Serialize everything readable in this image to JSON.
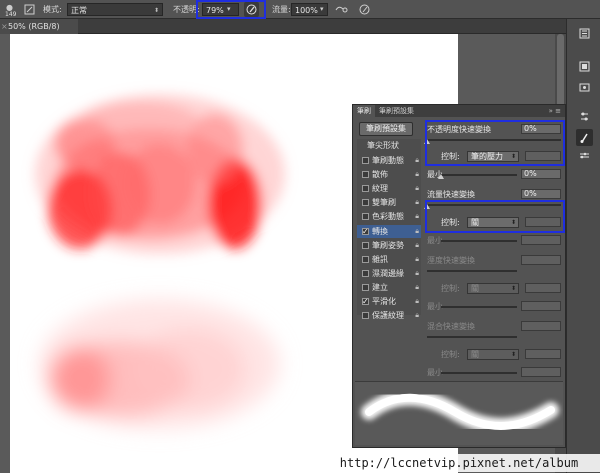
{
  "options_bar": {
    "brush_size": "149",
    "mode_label": "模式:",
    "mode_value": "正常",
    "opacity_label": "不透明:",
    "opacity_value": "79%",
    "flow_label": "流量:",
    "flow_value": "100%",
    "highlight_color": "#1f2ee0"
  },
  "document": {
    "tab_title": "50% (RGB/8)"
  },
  "panel": {
    "tabs": [
      "筆刷",
      "筆刷預設集"
    ],
    "preset_button": "筆刷預設集",
    "list_header": "筆尖形狀",
    "list": [
      {
        "label": "筆刷動態",
        "checked": false
      },
      {
        "label": "散佈",
        "checked": false
      },
      {
        "label": "紋理",
        "checked": false
      },
      {
        "label": "雙筆刷",
        "checked": false
      },
      {
        "label": "色彩動態",
        "checked": false
      },
      {
        "label": "轉換",
        "checked": true,
        "selected": true
      },
      {
        "label": "筆刷姿勢",
        "checked": false
      },
      {
        "label": "雜訊",
        "checked": false
      },
      {
        "label": "濕潤邊緣",
        "checked": false
      },
      {
        "label": "建立",
        "checked": false
      },
      {
        "label": "平滑化",
        "checked": true
      },
      {
        "label": "保護紋理",
        "checked": false
      }
    ],
    "opacity_jitter_label": "不透明度快速變換",
    "opacity_jitter_value": "0%",
    "control_label": "控制:",
    "opacity_control_value": "筆的壓力",
    "min_label": "最小",
    "opacity_min_value": "0%",
    "flow_jitter_label": "流量快速變換",
    "flow_jitter_value": "0%",
    "flow_control_value": "關",
    "wet_jitter_label": "溼度快速變換",
    "wet_control_value": "關",
    "mix_jitter_label": "混合快速變換",
    "mix_control_value": "關",
    "ui_accent": "#3e5f92"
  },
  "watermark": "http://lccnetvip.pixnet.net/album"
}
